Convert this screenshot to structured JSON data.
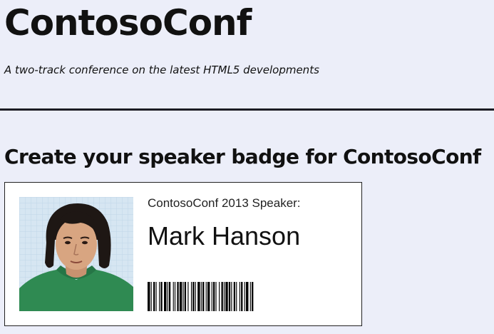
{
  "header": {
    "title": "ContosoConf",
    "tagline": "A two-track conference on the latest HTML5 developments"
  },
  "main": {
    "heading": "Create your speaker badge for ContosoConf",
    "badge": {
      "caption": "ContosoConf 2013 Speaker:",
      "speaker_name": "Mark Hanson",
      "photo_icon": "speaker-photo",
      "barcode_icon": "barcode-icon"
    }
  },
  "colors": {
    "page_background": "#eceef9",
    "divider": "#1c1c24",
    "badge_background": "#ffffff",
    "badge_border": "#222222"
  }
}
